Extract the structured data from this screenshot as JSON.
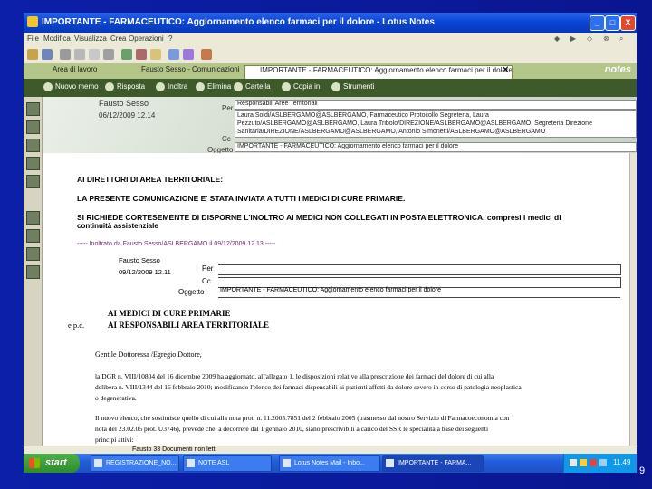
{
  "window": {
    "title": "IMPORTANTE - FARMACEUTICO: Aggiornamento elenco farmaci per il dolore - Lotus Notes",
    "controls": [
      "_",
      "□",
      "X"
    ]
  },
  "menu": {
    "items": [
      "File",
      "Modifica",
      "Visualizza",
      "Crea",
      "Operazioni",
      "?"
    ]
  },
  "tabs": {
    "items": [
      "Area di lavoro",
      "Fausto Sesso - Comunicazioni",
      "IMPORTANTE - FARMACEUTICO: Aggiornamento elenco farmaci per il dolore"
    ],
    "close": "✕",
    "logo": "notes"
  },
  "actions": {
    "items": [
      "Nuovo memo",
      "Risposta",
      "Inoltra",
      "Elimina",
      "Cartella",
      "Copia in",
      "Strumenti"
    ]
  },
  "header": {
    "sender": "Fausto Sesso",
    "date": "06/12/2009 12.14",
    "to_label": "Per",
    "cc_label": "Cc",
    "subject_label": "Oggetto",
    "to_value": "Responsabili Aree Territoriali",
    "cc_line1": "Laura Soldi/ASLBERGAMO@ASLBERGAMO, Farmaceutico Protocollo Segreteria, Laura",
    "cc_line2": "Pezzuto/ASLBERGAMO@ASLBERGAMO, Laura Tribolo/DIREZIONE/ASLBERGAMO@ASLBERGAMO, Segreteria Direzione",
    "cc_line3": "Sanitaria/DIREZIONE/ASLBERGAMO@ASLBERGAMO, Antonio Simonetti/ASLBERGAMO@ASLBERGAMO",
    "subject_value": "IMPORTANTE - FARMACEUTICO: Aggiornamento elenco farmaci per il dolore"
  },
  "body": {
    "line1": "AI DIRETTORI DI AREA TERRITORIALE:",
    "line2": "LA PRESENTE COMUNICAZIONE E' STATA INVIATA A TUTTI I MEDICI DI CURE PRIMARIE.",
    "line3": "SI RICHIEDE CORTESEMENTE DI DISPORNE L'INOLTRO AI MEDICI NON COLLEGATI IN POSTA ELETTRONICA, compresi i medici di",
    "line3b": "continuità assistenziale",
    "forward": "----- Inoltrato da Fausto Sesso/ASLBERGAMO il 09/12/2009 12.13 -----",
    "inner_sender": "Fausto Sesso",
    "inner_date": "09/12/2009 12.11",
    "inner_to": "Per",
    "inner_cc": "Cc",
    "inner_subject_label": "Oggetto",
    "inner_subject": "IMPORTANTE - FARMACEUTICO: Aggiornamento elenco farmaci per il dolore",
    "addressee1": "AI MEDICI DI CURE PRIMARIE",
    "epc": "e p.c.",
    "addressee2": "AI RESPONSABILI AREA TERRITORIALE",
    "greeting": "Gentile Dottoressa /Egregio Dottore,",
    "para1a": "la DGR n. VIII/10804 del 16 dicembre 2009 ha aggiornato, all'allegato 1, le disposizioni relative alla prescrizione dei farmaci del dolore di cui alla",
    "para1b": "delibera n. VIII/1344 del 16 febbraio 2010; modificando l'elenco dei farmaci dispensabili ai pazienti affetti da dolore severo in corso di patologia neoplastica",
    "para1c": "o degenerativa.",
    "para2a": "Il nuovo elenco, che sostituisce quello di cui alla nota prot. n. 11.2005.7851 del 2 febbraio 2005 (trasmesso dal nostro Servizio di Farmacoeconomia con",
    "para2b": "nota del 23.02.05 prot. U3746), prevede che, a decorrere dal 1 gennaio 2010, siano prescrivibili a carico del SSR le specialità a base dei seguenti",
    "para2c": "principi attivi:"
  },
  "status": {
    "text": "Fausto 33 Documenti non letti"
  },
  "taskbar": {
    "start": "start",
    "tasks": [
      "REGISTRAZIONE_NO...",
      "NOTE ASL",
      "Lotus Notes Mail - Inbo...",
      "IMPORTANTE - FARMA..."
    ],
    "clock": "11.49"
  },
  "slide": {
    "page_number": "9"
  }
}
